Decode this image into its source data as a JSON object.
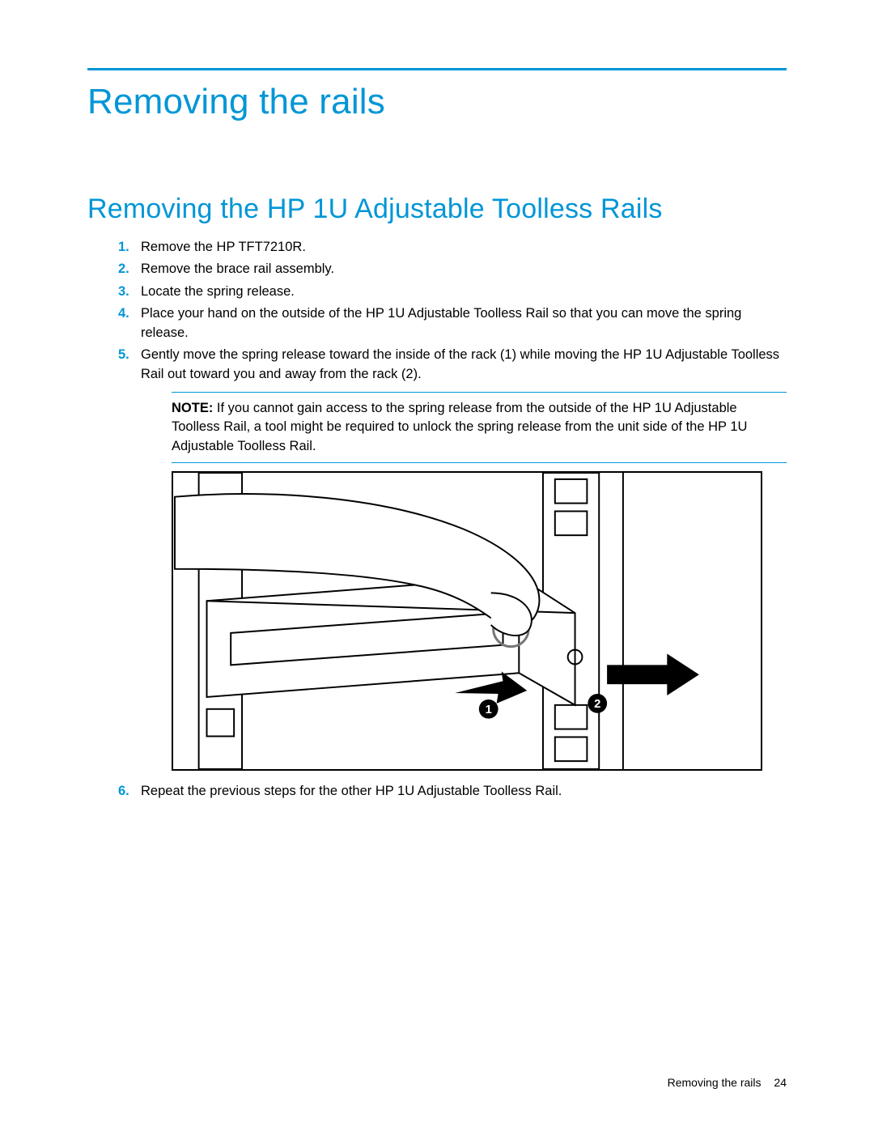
{
  "title": "Removing the rails",
  "section": "Removing the HP 1U Adjustable Toolless Rails",
  "steps": [
    {
      "num": "1.",
      "text": "Remove the HP TFT7210R."
    },
    {
      "num": "2.",
      "text": "Remove the brace rail assembly."
    },
    {
      "num": "3.",
      "text": "Locate the spring release."
    },
    {
      "num": "4.",
      "text": "Place your hand on the outside of the HP 1U Adjustable Toolless Rail so that you can move the spring release."
    },
    {
      "num": "5.",
      "text": "Gently move the spring release toward the inside of the rack (1) while moving the HP 1U Adjustable Toolless Rail out toward you and away from the rack (2)."
    },
    {
      "num": "6.",
      "text": "Repeat the previous steps for the other HP 1U Adjustable Toolless Rail."
    }
  ],
  "note": {
    "label": "NOTE:",
    "text": "  If you cannot gain access to the spring release from the outside of the HP 1U Adjustable Toolless Rail, a tool might be required to unlock the spring release from the unit side of the HP 1U Adjustable Toolless Rail."
  },
  "callouts": {
    "one": "1",
    "two": "2"
  },
  "footer": {
    "section": "Removing the rails",
    "page": "24"
  }
}
